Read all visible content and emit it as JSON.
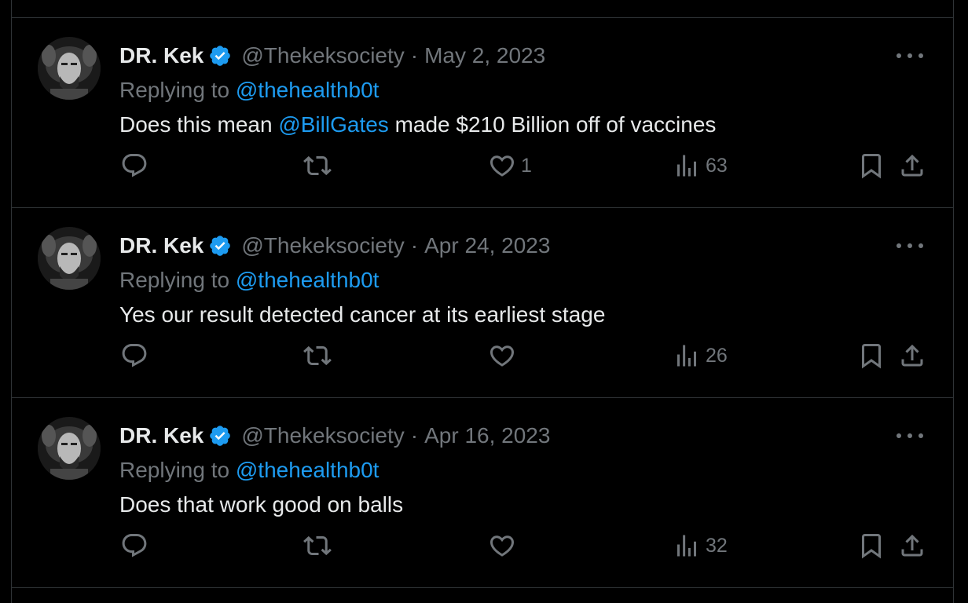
{
  "tweets": [
    {
      "name": "DR. Kek",
      "handle": "@Thekeksociety",
      "separator": "·",
      "date": "May 2, 2023",
      "replying_label": "Replying to",
      "replying_to": "@thehealthb0t",
      "text_parts": {
        "before": "Does this mean ",
        "mention": "@BillGates",
        "after": " made $210 Billion off of vaccines"
      },
      "likes": "1",
      "views": "63"
    },
    {
      "name": "DR. Kek",
      "handle": "@Thekeksociety",
      "separator": "·",
      "date": "Apr 24, 2023",
      "replying_label": "Replying to",
      "replying_to": "@thehealthb0t",
      "text_parts": {
        "before": "Yes our result detected cancer at its earliest stage",
        "mention": "",
        "after": ""
      },
      "likes": "",
      "views": "26"
    },
    {
      "name": "DR. Kek",
      "handle": "@Thekeksociety",
      "separator": "·",
      "date": "Apr 16, 2023",
      "replying_label": "Replying to",
      "replying_to": "@thehealthb0t",
      "text_parts": {
        "before": "Does that work good on balls",
        "mention": "",
        "after": ""
      },
      "likes": "",
      "views": "32"
    }
  ],
  "icons": {
    "verified": "verified-badge-icon",
    "more": "more-options-icon",
    "reply": "reply-icon",
    "retweet": "retweet-icon",
    "like": "heart-icon",
    "views": "analytics-icon",
    "bookmark": "bookmark-icon",
    "share": "share-icon"
  },
  "colors": {
    "background": "#000000",
    "text": "#e7e9ea",
    "secondary": "#71767b",
    "accent": "#1d9bf0",
    "divider": "#2f3336"
  }
}
